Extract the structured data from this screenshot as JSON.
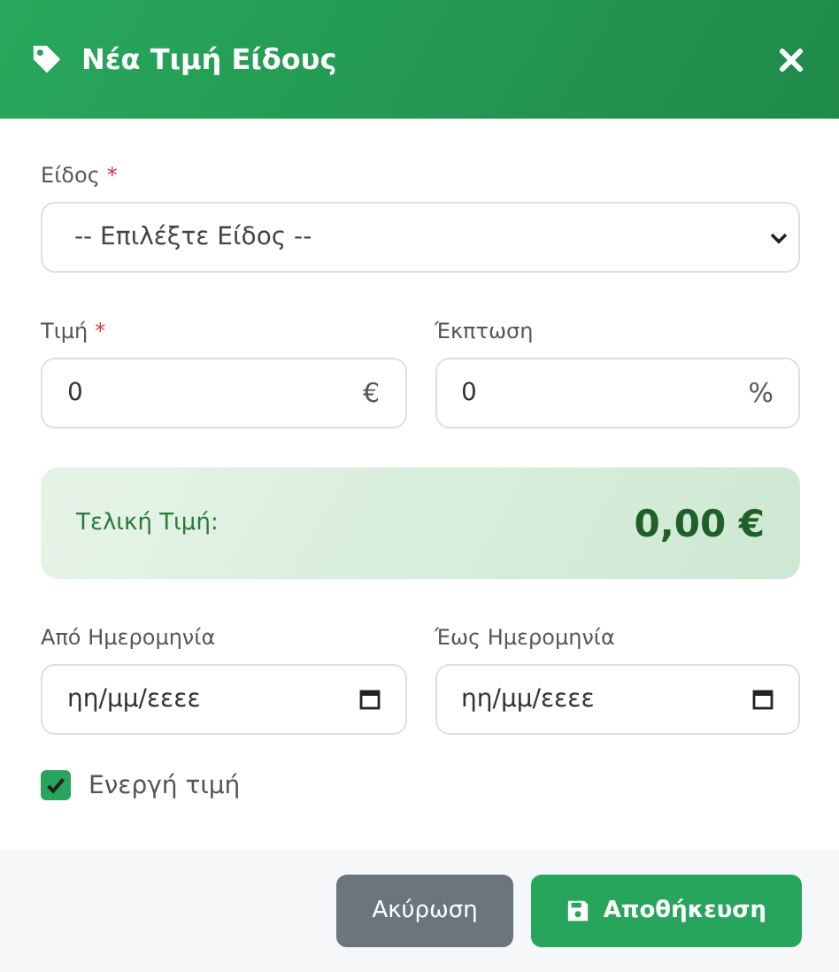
{
  "dialog": {
    "title": "Νέα Τιμή Είδους"
  },
  "item_field": {
    "label": "Είδος",
    "required_mark": "*",
    "value": "-- Επιλέξτε Είδος --"
  },
  "amount_fields": [
    {
      "label": "Τιμή",
      "required_mark": "*",
      "value": "0",
      "suffix": "€"
    },
    {
      "label": "Έκπτωση",
      "value": "0",
      "suffix": "%"
    }
  ],
  "final_price": {
    "label": "Τελική Τιμή:",
    "value": "0,00 €"
  },
  "date_fields": [
    {
      "label": "Από Ημερομηνία",
      "placeholder": "ηη/μμ/εεεε"
    },
    {
      "label": "Έως Ημερομηνία",
      "placeholder": "ηη/μμ/εεεε"
    }
  ],
  "active_checkbox": {
    "label": "Ενεργή τιμή",
    "checked": true
  },
  "buttons": [
    {
      "kind": "cancel",
      "label": "Ακύρωση"
    },
    {
      "kind": "save",
      "label": "Αποθήκευση"
    }
  ]
}
